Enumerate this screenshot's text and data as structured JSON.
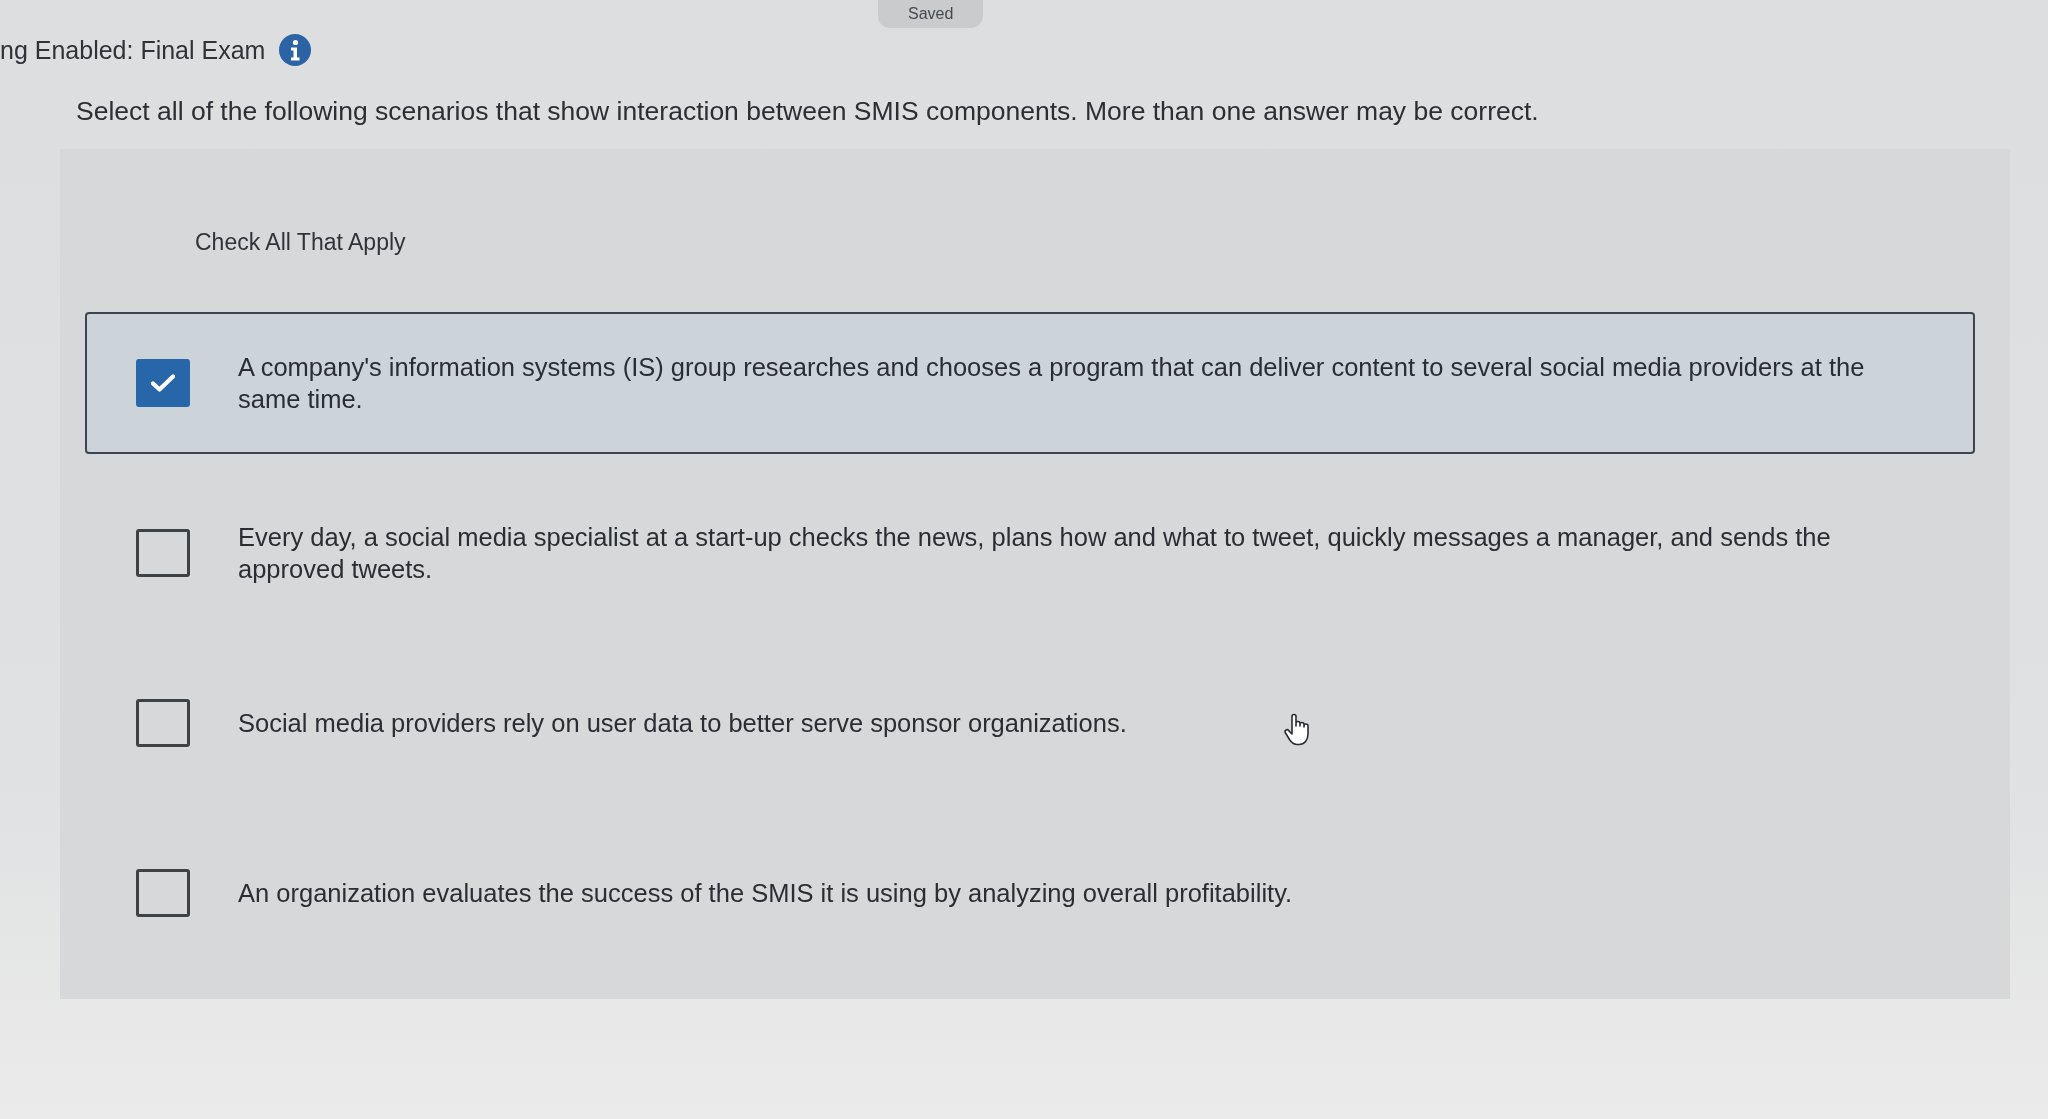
{
  "header": {
    "title": "ng Enabled: Final Exam",
    "save_status": "Saved"
  },
  "question": {
    "prompt": "Select all of the following scenarios that show interaction between SMIS components. More than one answer may be correct.",
    "instruction": "Check All That Apply",
    "options": [
      {
        "text": "A company's information systems (IS) group researches and chooses a program that can deliver content to several social media providers at the same time.",
        "checked": true
      },
      {
        "text": "Every day, a social media specialist at a start-up checks the news, plans how and what to tweet, quickly messages a manager, and sends the approved tweets.",
        "checked": false
      },
      {
        "text": "Social media providers rely on user data to better serve sponsor organizations.",
        "checked": false
      },
      {
        "text": "An organization evaluates the success of the SMIS it is using by analyzing overall profitability.",
        "checked": false
      }
    ]
  }
}
